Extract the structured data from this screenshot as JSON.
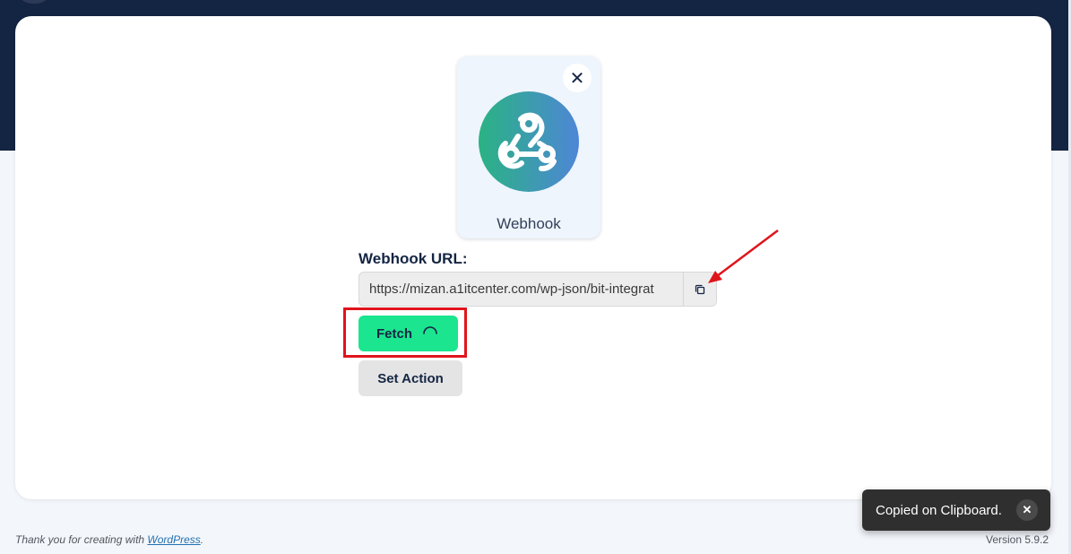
{
  "tile": {
    "name": "Webhook",
    "close_glyph": "✕",
    "icon": "webhook-icon",
    "gradient_start": "#2ab383",
    "gradient_end": "#4e86d6"
  },
  "form": {
    "url_label": "Webhook URL:",
    "url_value": "https://mizan.a1itcenter.com/wp-json/bit-integrat",
    "copy_icon": "copy-icon",
    "fetch_label": "Fetch",
    "set_action_label": "Set Action"
  },
  "toast": {
    "message": "Copied on Clipboard.",
    "close_glyph": "✕"
  },
  "footer": {
    "thanks_prefix": "Thank you for creating with ",
    "wordpress_link": "WordPress",
    "thanks_suffix": ".",
    "version": "Version 5.9.2"
  },
  "colors": {
    "header_navy": "#142543",
    "fetch_green": "#1be58f",
    "annotation_red": "#e0141b"
  }
}
